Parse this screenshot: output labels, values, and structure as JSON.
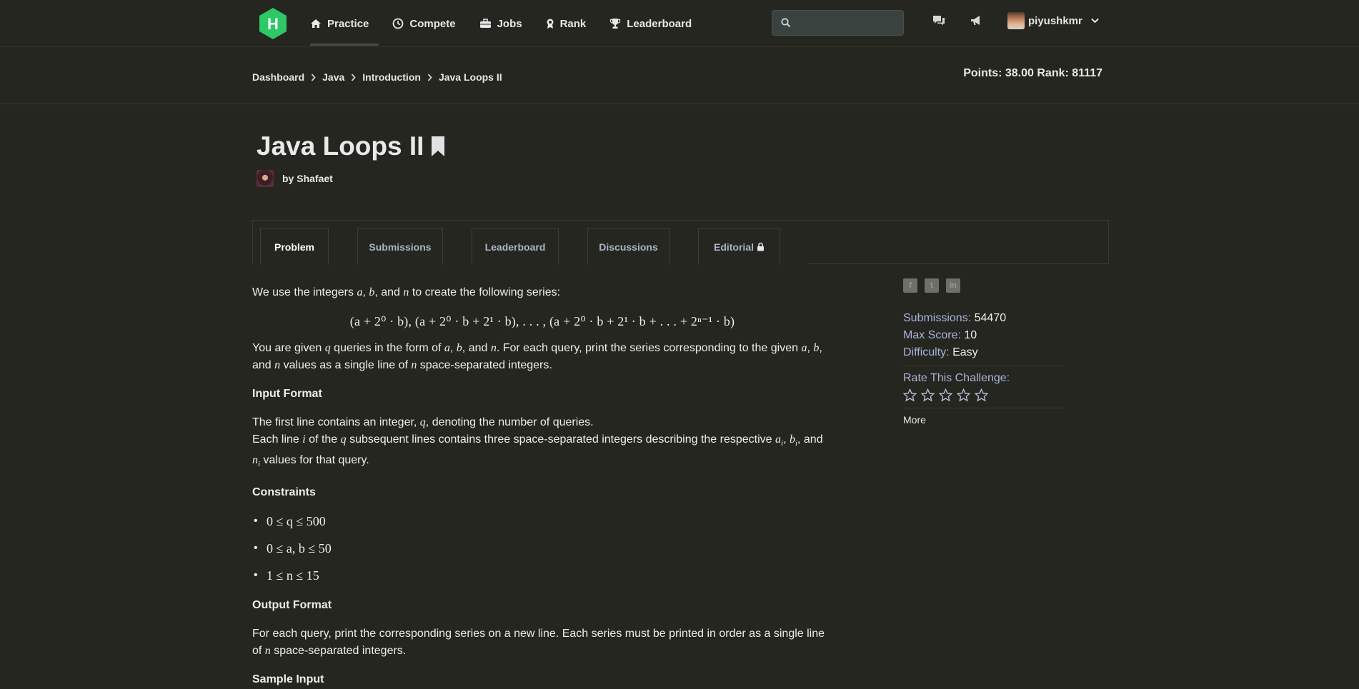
{
  "header": {
    "logo_letter": "H",
    "nav": [
      {
        "label": "Practice",
        "icon": "home-icon"
      },
      {
        "label": "Compete",
        "icon": "clock-icon"
      },
      {
        "label": "Jobs",
        "icon": "briefcase-icon"
      },
      {
        "label": "Rank",
        "icon": "medal-icon"
      },
      {
        "label": "Leaderboard",
        "icon": "trophy-icon"
      }
    ],
    "search_placeholder": "",
    "username": "piyushkmr"
  },
  "breadcrumb": [
    "Dashboard",
    "Java",
    "Introduction",
    "Java Loops II"
  ],
  "points_rank": "Points: 38.00 Rank: 81117",
  "challenge": {
    "title": "Java Loops II",
    "author": "by Shafaet"
  },
  "tabs": [
    "Problem",
    "Submissions",
    "Leaderboard",
    "Discussions",
    "Editorial"
  ],
  "problem": {
    "intro_pre": "We use the integers ",
    "intro_post": " to create the following series:",
    "formula": "(a + 2⁰ · b), (a + 2⁰ · b + 2¹ · b), . . . , (a + 2⁰ · b + 2¹ · b + . . . + 2ⁿ⁻¹ · b)",
    "queries_text_1": "You are given ",
    "queries_text_2": " queries in the form of ",
    "queries_text_3": ". For each query, print the series corresponding to the given ",
    "queries_text_4": " values as a single line of ",
    "queries_text_5": " space-separated integers.",
    "input_format_heading": "Input Format",
    "input_line1_pre": "The first line contains an integer, ",
    "input_line1_post": ", denoting the number of queries.",
    "input_line2_a": "Each line ",
    "input_line2_b": " of the ",
    "input_line2_c": " subsequent lines contains three space-separated integers describing the respective ",
    "input_line2_d": " values for that query.",
    "constraints_heading": "Constraints",
    "constraints": [
      "0 ≤ q ≤ 500",
      "0 ≤ a, b ≤ 50",
      "1 ≤ n ≤ 15"
    ],
    "output_format_heading": "Output Format",
    "output_text_1": "For each query, print the corresponding series on a new line. Each series must be printed in order as a single line of ",
    "output_text_2": " space-separated integers.",
    "sample_input_heading": "Sample Input"
  },
  "sidebar": {
    "submissions_label": "Submissions:",
    "submissions_value": "54470",
    "max_score_label": "Max Score:",
    "max_score_value": "10",
    "difficulty_label": "Difficulty:",
    "difficulty_value": "Easy",
    "rate_label": "Rate This Challenge:",
    "star_count": 5,
    "more_label": "More"
  },
  "colors": {
    "logo_green": "#2ec866",
    "background": "#262621",
    "label_blue": "#a8b4d8"
  }
}
